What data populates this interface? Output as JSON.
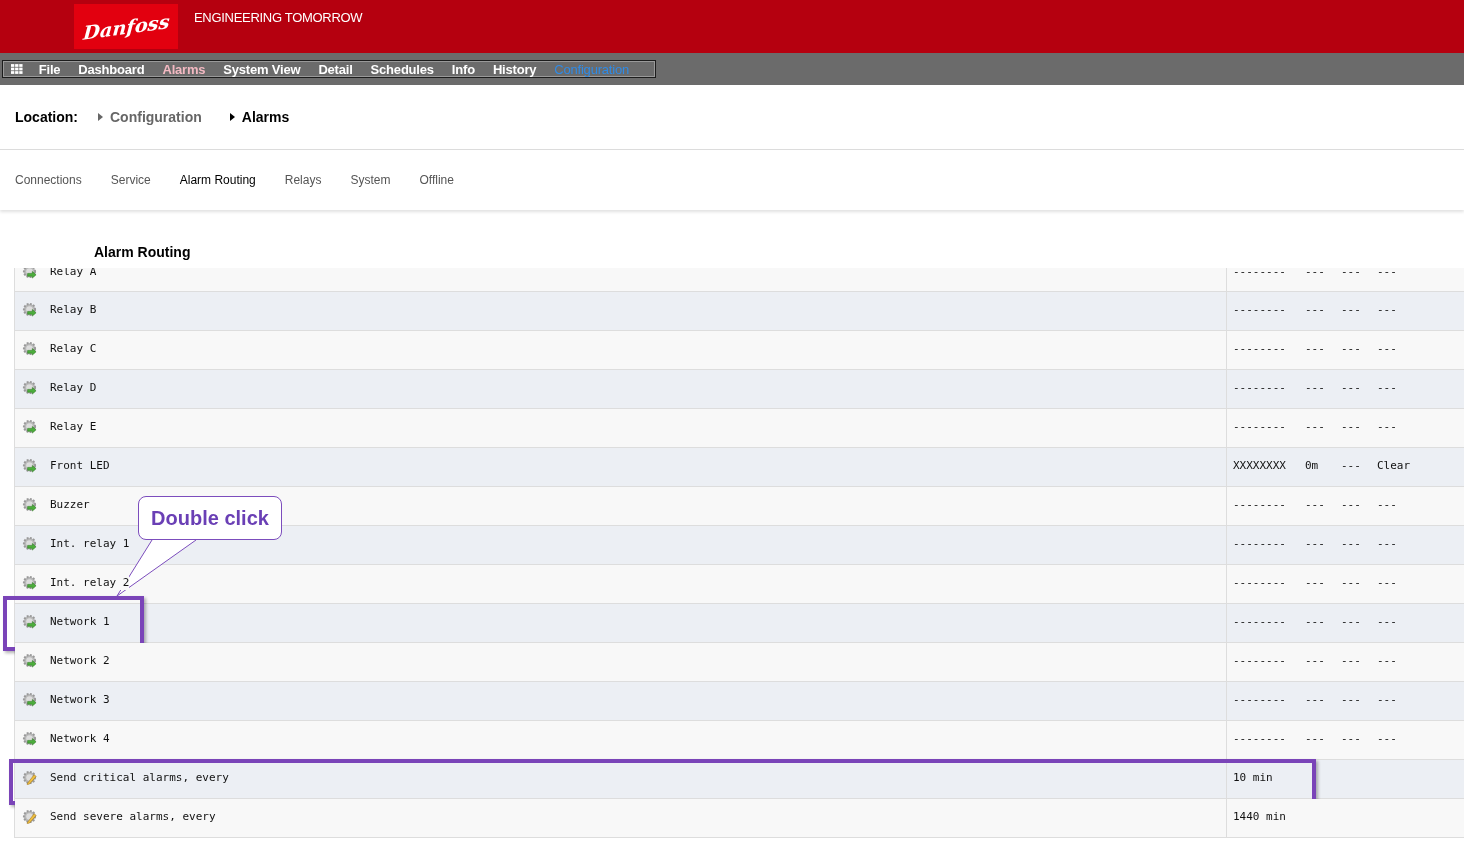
{
  "header": {
    "logo": "Danfoss",
    "tagline": "ENGINEERING TOMORROW"
  },
  "menu": [
    {
      "label": "File",
      "selected": false,
      "alert": false
    },
    {
      "label": "Dashboard",
      "selected": false,
      "alert": false
    },
    {
      "label": "Alarms",
      "selected": false,
      "alert": true
    },
    {
      "label": "System View",
      "selected": false,
      "alert": false
    },
    {
      "label": "Detail",
      "selected": false,
      "alert": false
    },
    {
      "label": "Schedules",
      "selected": false,
      "alert": false
    },
    {
      "label": "Info",
      "selected": false,
      "alert": false
    },
    {
      "label": "History",
      "selected": false,
      "alert": false
    },
    {
      "label": "Configuration",
      "selected": true,
      "alert": false
    }
  ],
  "location": {
    "label": "Location:",
    "crumbs": [
      {
        "label": "Configuration",
        "selected": false
      },
      {
        "label": "Alarms",
        "selected": true
      }
    ]
  },
  "tabs": [
    {
      "label": "Connections",
      "selected": false
    },
    {
      "label": "Service",
      "selected": false
    },
    {
      "label": "Alarm Routing",
      "selected": true
    },
    {
      "label": "Relays",
      "selected": false
    },
    {
      "label": "System",
      "selected": false
    },
    {
      "label": "Offline",
      "selected": false
    }
  ],
  "section_title": "Alarm Routing",
  "rows": [
    {
      "kind": "route",
      "name": "Relay A",
      "values": [
        "--------",
        "---",
        "---",
        "---"
      ],
      "highlighted": false
    },
    {
      "kind": "route",
      "name": "Relay B",
      "values": [
        "--------",
        "---",
        "---",
        "---"
      ],
      "highlighted": false
    },
    {
      "kind": "route",
      "name": "Relay C",
      "values": [
        "--------",
        "---",
        "---",
        "---"
      ],
      "highlighted": false
    },
    {
      "kind": "route",
      "name": "Relay D",
      "values": [
        "--------",
        "---",
        "---",
        "---"
      ],
      "highlighted": false
    },
    {
      "kind": "route",
      "name": "Relay E",
      "values": [
        "--------",
        "---",
        "---",
        "---"
      ],
      "highlighted": false
    },
    {
      "kind": "route",
      "name": "Front LED",
      "values": [
        "XXXXXXXX",
        "0m",
        "---",
        "Clear"
      ],
      "highlighted": false
    },
    {
      "kind": "route",
      "name": "Buzzer",
      "values": [
        "--------",
        "---",
        "---",
        "---"
      ],
      "highlighted": false
    },
    {
      "kind": "route",
      "name": "Int. relay 1",
      "values": [
        "--------",
        "---",
        "---",
        "---"
      ],
      "highlighted": false
    },
    {
      "kind": "route",
      "name": "Int. relay 2",
      "values": [
        "--------",
        "---",
        "---",
        "---"
      ],
      "highlighted": false
    },
    {
      "kind": "route",
      "name": "Network 1",
      "values": [
        "--------",
        "---",
        "---",
        "---"
      ],
      "highlighted": true
    },
    {
      "kind": "route",
      "name": "Network 2",
      "values": [
        "--------",
        "---",
        "---",
        "---"
      ],
      "highlighted": false
    },
    {
      "kind": "route",
      "name": "Network 3",
      "values": [
        "--------",
        "---",
        "---",
        "---"
      ],
      "highlighted": false
    },
    {
      "kind": "route",
      "name": "Network 4",
      "values": [
        "--------",
        "---",
        "---",
        "---"
      ],
      "highlighted": false
    },
    {
      "kind": "interval",
      "name": "Send critical alarms, every",
      "values": [
        "10 min"
      ],
      "highlighted": true
    },
    {
      "kind": "interval",
      "name": "Send severe alarms, every",
      "values": [
        "1440 min"
      ],
      "highlighted": false
    }
  ],
  "callout": {
    "text": "Double click"
  }
}
